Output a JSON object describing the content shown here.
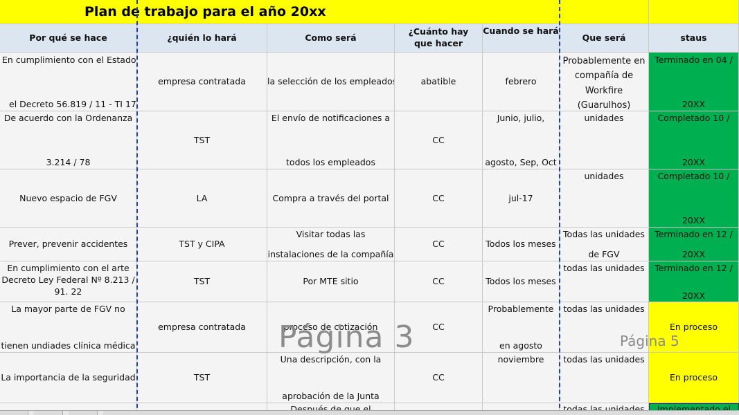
{
  "title": "Plan de trabajo para el año 20xx",
  "headers": [
    "Por qué se hace",
    "¿quién lo hará",
    "Como será",
    "¿Cuánto hay que hacer",
    "Cuando se hará",
    "Que será",
    "staus"
  ],
  "rows": [
    {
      "why": [
        "En cumplimiento con el Estado",
        "el Decreto 56.819 / 11 - TI 17"
      ],
      "who": "empresa contratada",
      "how": "la selección de los empleados",
      "howmuch": "abatible",
      "when": [
        "febrero"
      ],
      "what": [
        "Probablemente en",
        "compañía de",
        "Workfire",
        "(Guarulhos)"
      ],
      "status": [
        "Terminado en 04 /",
        "20XX"
      ],
      "status_color": "green"
    },
    {
      "why": [
        "De acuerdo con la Ordenanza",
        "3.214 / 78"
      ],
      "who": "TST",
      "how": [
        "El envío de notificaciones a",
        "todos los empleados"
      ],
      "howmuch": "CC",
      "when": [
        "Junio, julio,",
        "agosto, Sep, Oct"
      ],
      "what": [
        "unidades"
      ],
      "status": [
        "Completado 10 /",
        "20XX"
      ],
      "status_color": "green"
    },
    {
      "why": [
        "Nuevo espacio de FGV"
      ],
      "who": "LA",
      "how": [
        "Compra a través del portal"
      ],
      "howmuch": "CC",
      "when": [
        "jul-17"
      ],
      "what": [
        "unidades"
      ],
      "status": [
        "Completado 10 /",
        "20XX"
      ],
      "status_color": "green"
    },
    {
      "why": [
        "Prever, prevenir accidentes"
      ],
      "who": "TST y CIPA",
      "how": [
        "Visitar todas las",
        "instalaciones de la compañía"
      ],
      "howmuch": "CC",
      "when": [
        "Todos los meses"
      ],
      "what": [
        "Todas las unidades",
        "de FGV"
      ],
      "status": [
        "Terminado en 12 /",
        "20XX"
      ],
      "status_color": "green"
    },
    {
      "why": [
        "En cumplimiento con el arte",
        "Decreto Ley Federal Nº 8.213 /",
        "91. 22"
      ],
      "who": "TST",
      "how": [
        "Por MTE sitio"
      ],
      "howmuch": "CC",
      "when": [
        "Todos los meses"
      ],
      "what": [
        "todas las unidades"
      ],
      "status": [
        "Terminado en 12 /",
        "20XX"
      ],
      "status_color": "green"
    },
    {
      "why": [
        "La mayor parte de FGV no",
        "tienen undiades clínica médica"
      ],
      "who": "empresa contratada",
      "how": [
        "proceso de cotización"
      ],
      "howmuch": "CC",
      "when": [
        "Probablemente",
        "en agosto"
      ],
      "what": [
        "todas las unidades"
      ],
      "status": [
        "En proceso"
      ],
      "status_color": "yellow"
    },
    {
      "why": [
        "La importancia de la seguridad"
      ],
      "who": "TST",
      "how": [
        "Una descripción, con la",
        "aprobación de la Junta"
      ],
      "howmuch": "CC",
      "when": [
        "noviembre"
      ],
      "what": [
        "todas las unidades"
      ],
      "status": [
        "En proceso"
      ],
      "status_color": "yellow"
    },
    {
      "why": [
        ""
      ],
      "who": "",
      "how": [
        "Después de que el"
      ],
      "howmuch": "",
      "when": [
        ""
      ],
      "what": [
        "todas las unidades"
      ],
      "status": [
        "Implementado el"
      ],
      "status_color": "green"
    }
  ],
  "watermarks": {
    "page3": "Página 3",
    "page5": "Página 5"
  },
  "colors": {
    "green": "#00b050",
    "yellow": "#ffff00",
    "header_bg": "#dce6f1",
    "page_break": "#1f3fb4"
  }
}
